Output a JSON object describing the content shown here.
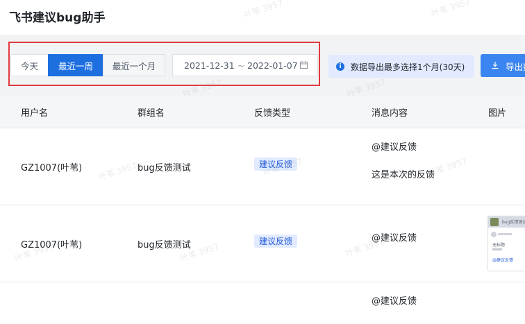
{
  "app": {
    "title": "飞书建议bug助手"
  },
  "filters": {
    "segments": [
      "今天",
      "最近一周",
      "最近一个月"
    ],
    "selected": "最近一周",
    "date_start": "2021-12-31",
    "date_separator": "~",
    "date_end": "2022-01-07"
  },
  "notice": {
    "text": "数据导出最多选择1个月(30天)"
  },
  "export": {
    "label": "导出数据"
  },
  "table": {
    "headers": [
      "用户名",
      "群组名",
      "反馈类型",
      "消息内容",
      "图片"
    ],
    "rows": [
      {
        "user": "GZ1007(叶苇)",
        "group": "bug反馈测试",
        "type": "建议反馈",
        "message_line1": "@建议反馈",
        "message_line2": "这是本次的反馈"
      },
      {
        "user": "GZ1007(叶苇)",
        "group": "bug反馈测试",
        "type": "建议反馈",
        "message_line1": "@建议反馈",
        "image": {
          "title": "bug反馈测试",
          "line1": "无标题",
          "line2": "@建议反馈"
        }
      },
      {
        "message_line1": "@建议反馈"
      }
    ]
  },
  "watermark": "叶苇 3957",
  "colors": {
    "primary": "#1d6fe0",
    "highlight_border": "#e0393e",
    "tag_bg": "#e1eaff",
    "tag_text": "#245bdb"
  }
}
